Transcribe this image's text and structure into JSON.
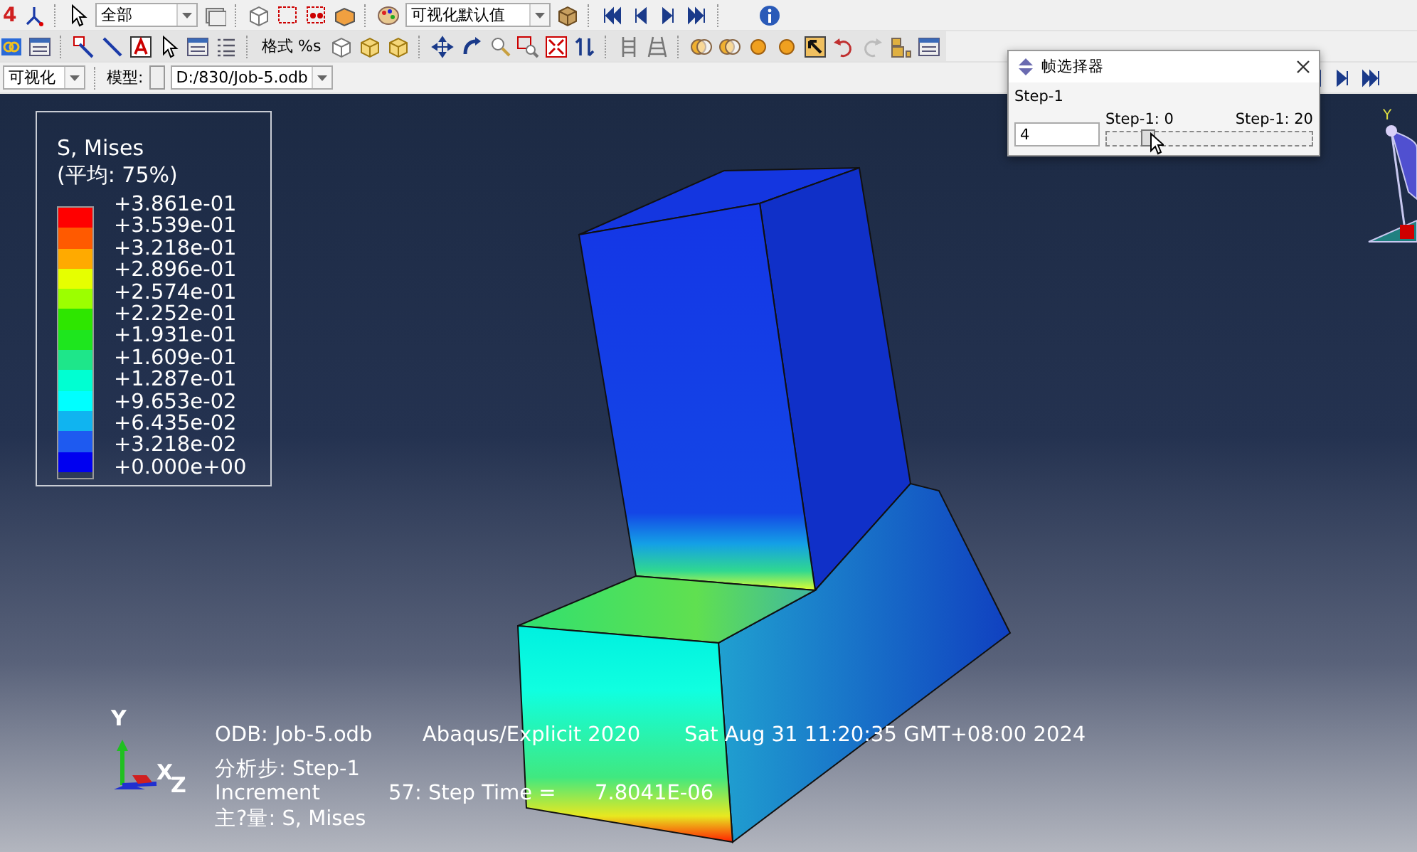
{
  "toolbar_top": {
    "leading_text": "4",
    "selection_dropdown": {
      "value": "全部"
    },
    "view_dropdown": {
      "value": "可视化默认值"
    }
  },
  "toolbar_second": {
    "format_button": "格式 %s"
  },
  "context_bar": {
    "module_dropdown": {
      "value": "可视化"
    },
    "model_label": "模型:",
    "model_dropdown": {
      "value": "D:/830/Job-5.odb"
    }
  },
  "viewport": {
    "legend": {
      "title": "S, Mises",
      "subtitle": "(平均: 75%)",
      "labels": [
        "+3.861e-01",
        "+3.539e-01",
        "+3.218e-01",
        "+2.896e-01",
        "+2.574e-01",
        "+2.252e-01",
        "+1.931e-01",
        "+1.609e-01",
        "+1.287e-01",
        "+9.653e-02",
        "+6.435e-02",
        "+3.218e-02",
        "+0.000e+00"
      ],
      "bands": [
        {
          "color": "#ff0000"
        },
        {
          "color": "#ff5a00"
        },
        {
          "color": "#ffaa00"
        },
        {
          "color": "#e6ff00"
        },
        {
          "color": "#9cff00"
        },
        {
          "color": "#2ee600"
        },
        {
          "color": "#1ee61e"
        },
        {
          "color": "#1ee68a"
        },
        {
          "color": "#00ffd2"
        },
        {
          "color": "#00ffff"
        },
        {
          "color": "#10b4f0"
        },
        {
          "color": "#1e5af0"
        },
        {
          "color": "#0000f0"
        }
      ]
    },
    "triad": {
      "y": "Y",
      "x": "X",
      "z": "Z"
    },
    "view_cube_label": "Y",
    "info": {
      "odb": "ODB: Job-5.odb",
      "product": "Abaqus/Explicit 2020",
      "date": "Sat Aug 31 11:20:35 GMT+08:00 2024",
      "step": "分析步: Step-1",
      "increment_label": "Increment",
      "increment": "57: Step Time =",
      "step_time": "7.8041E-06",
      "variable": "主?量: S, Mises"
    }
  },
  "frame_selector": {
    "title": "帧选择器",
    "step_label": "Step-1",
    "frame_value": "4",
    "min_label": "Step-1: 0",
    "max_label": "Step-1: 20",
    "level": 0.2
  }
}
